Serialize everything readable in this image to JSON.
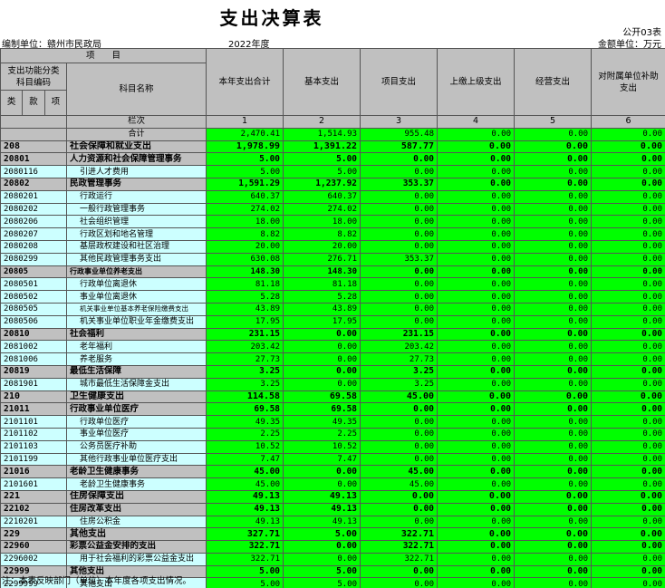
{
  "title": "支出决算表",
  "form_no": "公开03表",
  "unit_label": "编制单位：赣州市民政局",
  "year": "2022年度",
  "money_unit": "金额单位：万元",
  "header": {
    "xiangmu": "项　　目",
    "code_group": "支出功能分类科目编码",
    "subject_name": "科目名称",
    "col_total": "本年支出合计",
    "col_basic": "基本支出",
    "col_project": "项目支出",
    "col_upper": "上缴上级支出",
    "col_business": "经营支出",
    "col_subsidy": "对附属单位补助支出",
    "lei": "类",
    "kuan": "款",
    "xiang": "项",
    "lanci": "栏次",
    "n1": "1",
    "n2": "2",
    "n3": "3",
    "n4": "4",
    "n5": "5",
    "n6": "6",
    "heji": "合计",
    "heji_values": [
      "2,470.41",
      "1,514.93",
      "955.48",
      "0.00",
      "0.00",
      "0.00"
    ]
  },
  "rows": [
    {
      "code": "208",
      "name": "社会保障和就业支出",
      "level": 1,
      "values": [
        "1,978.99",
        "1,391.22",
        "587.77",
        "0.00",
        "0.00",
        "0.00"
      ]
    },
    {
      "code": "20801",
      "name": "人力资源和社会保障管理事务",
      "level": 2,
      "values": [
        "5.00",
        "5.00",
        "0.00",
        "0.00",
        "0.00",
        "0.00"
      ]
    },
    {
      "code": "2080116",
      "name": "引进人才费用",
      "level": 3,
      "values": [
        "5.00",
        "5.00",
        "0.00",
        "0.00",
        "0.00",
        "0.00"
      ]
    },
    {
      "code": "20802",
      "name": "民政管理事务",
      "level": 2,
      "values": [
        "1,591.29",
        "1,237.92",
        "353.37",
        "0.00",
        "0.00",
        "0.00"
      ]
    },
    {
      "code": "2080201",
      "name": "行政运行",
      "level": 3,
      "values": [
        "640.37",
        "640.37",
        "0.00",
        "0.00",
        "0.00",
        "0.00"
      ]
    },
    {
      "code": "2080202",
      "name": "一般行政管理事务",
      "level": 3,
      "values": [
        "274.02",
        "274.02",
        "0.00",
        "0.00",
        "0.00",
        "0.00"
      ]
    },
    {
      "code": "2080206",
      "name": "社会组织管理",
      "level": 3,
      "values": [
        "18.00",
        "18.00",
        "0.00",
        "0.00",
        "0.00",
        "0.00"
      ]
    },
    {
      "code": "2080207",
      "name": "行政区划和地名管理",
      "level": 3,
      "values": [
        "8.82",
        "8.82",
        "0.00",
        "0.00",
        "0.00",
        "0.00"
      ]
    },
    {
      "code": "2080208",
      "name": "基层政权建设和社区治理",
      "level": 3,
      "values": [
        "20.00",
        "20.00",
        "0.00",
        "0.00",
        "0.00",
        "0.00"
      ]
    },
    {
      "code": "2080299",
      "name": "其他民政管理事务支出",
      "level": 3,
      "values": [
        "630.08",
        "276.71",
        "353.37",
        "0.00",
        "0.00",
        "0.00"
      ]
    },
    {
      "code": "20805",
      "name": "行政事业单位养老支出",
      "level": 2,
      "small": true,
      "values": [
        "148.30",
        "148.30",
        "0.00",
        "0.00",
        "0.00",
        "0.00"
      ]
    },
    {
      "code": "2080501",
      "name": "行政单位离退休",
      "level": 3,
      "values": [
        "81.18",
        "81.18",
        "0.00",
        "0.00",
        "0.00",
        "0.00"
      ]
    },
    {
      "code": "2080502",
      "name": "事业单位离退休",
      "level": 3,
      "values": [
        "5.28",
        "5.28",
        "0.00",
        "0.00",
        "0.00",
        "0.00"
      ]
    },
    {
      "code": "2080505",
      "name": "机关事业单位基本养老保险缴费支出",
      "level": 3,
      "small": true,
      "values": [
        "43.89",
        "43.89",
        "0.00",
        "0.00",
        "0.00",
        "0.00"
      ]
    },
    {
      "code": "2080506",
      "name": "机关事业单位职业年金缴费支出",
      "level": 3,
      "values": [
        "17.95",
        "17.95",
        "0.00",
        "0.00",
        "0.00",
        "0.00"
      ]
    },
    {
      "code": "20810",
      "name": "社会福利",
      "level": 2,
      "values": [
        "231.15",
        "0.00",
        "231.15",
        "0.00",
        "0.00",
        "0.00"
      ]
    },
    {
      "code": "2081002",
      "name": "老年福利",
      "level": 3,
      "values": [
        "203.42",
        "0.00",
        "203.42",
        "0.00",
        "0.00",
        "0.00"
      ]
    },
    {
      "code": "2081006",
      "name": "养老服务",
      "level": 3,
      "values": [
        "27.73",
        "0.00",
        "27.73",
        "0.00",
        "0.00",
        "0.00"
      ]
    },
    {
      "code": "20819",
      "name": "最低生活保障",
      "level": 2,
      "values": [
        "3.25",
        "0.00",
        "3.25",
        "0.00",
        "0.00",
        "0.00"
      ]
    },
    {
      "code": "2081901",
      "name": "城市最低生活保障金支出",
      "level": 3,
      "values": [
        "3.25",
        "0.00",
        "3.25",
        "0.00",
        "0.00",
        "0.00"
      ]
    },
    {
      "code": "210",
      "name": "卫生健康支出",
      "level": 1,
      "values": [
        "114.58",
        "69.58",
        "45.00",
        "0.00",
        "0.00",
        "0.00"
      ]
    },
    {
      "code": "21011",
      "name": "行政事业单位医疗",
      "level": 2,
      "values": [
        "69.58",
        "69.58",
        "0.00",
        "0.00",
        "0.00",
        "0.00"
      ]
    },
    {
      "code": "2101101",
      "name": "行政单位医疗",
      "level": 3,
      "values": [
        "49.35",
        "49.35",
        "0.00",
        "0.00",
        "0.00",
        "0.00"
      ]
    },
    {
      "code": "2101102",
      "name": "事业单位医疗",
      "level": 3,
      "values": [
        "2.25",
        "2.25",
        "0.00",
        "0.00",
        "0.00",
        "0.00"
      ]
    },
    {
      "code": "2101103",
      "name": "公务员医疗补助",
      "level": 3,
      "values": [
        "10.52",
        "10.52",
        "0.00",
        "0.00",
        "0.00",
        "0.00"
      ]
    },
    {
      "code": "2101199",
      "name": "其他行政事业单位医疗支出",
      "level": 3,
      "values": [
        "7.47",
        "7.47",
        "0.00",
        "0.00",
        "0.00",
        "0.00"
      ]
    },
    {
      "code": "21016",
      "name": "老龄卫生健康事务",
      "level": 2,
      "values": [
        "45.00",
        "0.00",
        "45.00",
        "0.00",
        "0.00",
        "0.00"
      ]
    },
    {
      "code": "2101601",
      "name": "老龄卫生健康事务",
      "level": 3,
      "values": [
        "45.00",
        "0.00",
        "45.00",
        "0.00",
        "0.00",
        "0.00"
      ]
    },
    {
      "code": "221",
      "name": "住房保障支出",
      "level": 1,
      "values": [
        "49.13",
        "49.13",
        "0.00",
        "0.00",
        "0.00",
        "0.00"
      ]
    },
    {
      "code": "22102",
      "name": "住房改革支出",
      "level": 2,
      "values": [
        "49.13",
        "49.13",
        "0.00",
        "0.00",
        "0.00",
        "0.00"
      ]
    },
    {
      "code": "2210201",
      "name": "住房公积金",
      "level": 3,
      "values": [
        "49.13",
        "49.13",
        "0.00",
        "0.00",
        "0.00",
        "0.00"
      ]
    },
    {
      "code": "229",
      "name": "其他支出",
      "level": 1,
      "values": [
        "327.71",
        "5.00",
        "322.71",
        "0.00",
        "0.00",
        "0.00"
      ]
    },
    {
      "code": "22960",
      "name": "彩票公益金安排的支出",
      "level": 2,
      "values": [
        "322.71",
        "0.00",
        "322.71",
        "0.00",
        "0.00",
        "0.00"
      ]
    },
    {
      "code": "2296002",
      "name": "用于社会福利的彩票公益金支出",
      "level": 3,
      "values": [
        "322.71",
        "0.00",
        "322.71",
        "0.00",
        "0.00",
        "0.00"
      ]
    },
    {
      "code": "22999",
      "name": "其他支出",
      "level": 2,
      "values": [
        "5.00",
        "5.00",
        "0.00",
        "0.00",
        "0.00",
        "0.00"
      ]
    },
    {
      "code": "2299999",
      "name": "其他支出",
      "level": 3,
      "values": [
        "5.00",
        "5.00",
        "0.00",
        "0.00",
        "0.00",
        "0.00"
      ]
    }
  ],
  "note": "注：本表反映部门（单位）本年度各项支出情况。"
}
